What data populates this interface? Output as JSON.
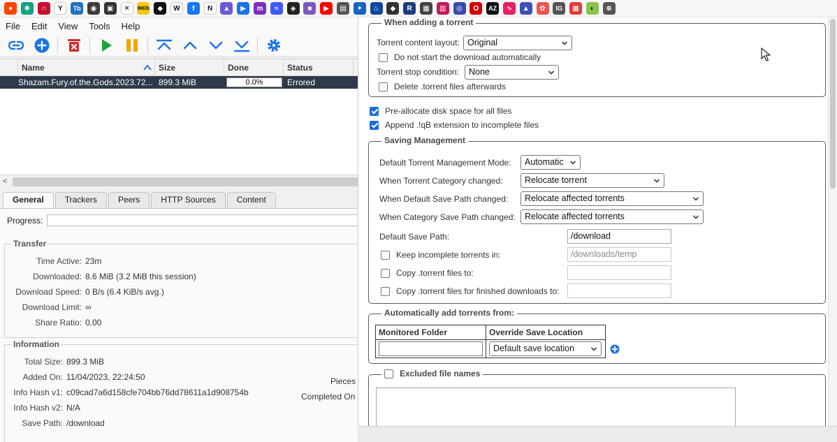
{
  "bookmarks": [
    {
      "icon": "reddit-icon",
      "color": "#ff4500",
      "glyph": "●"
    },
    {
      "icon": "chatgpt-icon",
      "color": "#10a37f",
      "glyph": "✺"
    },
    {
      "icon": "headphones-icon",
      "color": "#c8102e",
      "glyph": "∩"
    },
    {
      "icon": "yahoo-icon",
      "color": "#ffffff",
      "glyph": "Y"
    },
    {
      "icon": "tb-icon",
      "color": "#1e73be",
      "glyph": "Tb"
    },
    {
      "icon": "ring-icon",
      "color": "#3b3b3b",
      "glyph": "◉"
    },
    {
      "icon": "monitor-icon",
      "color": "#333333",
      "glyph": "▣"
    },
    {
      "icon": "x-icon",
      "color": "#ffffff",
      "glyph": "✕"
    },
    {
      "icon": "imdb-icon",
      "color": "#f5c518",
      "glyph": "IMDb"
    },
    {
      "icon": "badge-icon",
      "color": "#111111",
      "glyph": "◆"
    },
    {
      "icon": "wikipedia-icon",
      "color": "#ffffff",
      "glyph": "W"
    },
    {
      "icon": "facebook-icon",
      "color": "#1877f2",
      "glyph": "f"
    },
    {
      "icon": "netflix-icon",
      "color": "#ffffff",
      "glyph": "N"
    },
    {
      "icon": "triangle-icon",
      "color": "#6b5bd2",
      "glyph": "▲"
    },
    {
      "icon": "play-icon",
      "color": "#1a73e8",
      "glyph": "▶"
    },
    {
      "icon": "m-icon",
      "color": "#7b2fbf",
      "glyph": "m"
    },
    {
      "icon": "wifi-icon",
      "color": "#3d5afe",
      "glyph": "≈"
    },
    {
      "icon": "film-icon",
      "color": "#222222",
      "glyph": "◈"
    },
    {
      "icon": "camera-icon",
      "color": "#7e57c2",
      "glyph": "■"
    },
    {
      "icon": "youtube-icon",
      "color": "#ff0000",
      "glyph": "▶"
    },
    {
      "icon": "stack-icon",
      "color": "#555555",
      "glyph": "▤"
    },
    {
      "icon": "app-icon",
      "color": "#1565c0",
      "glyph": "✦"
    },
    {
      "icon": "droplet-icon",
      "color": "#0d47a1",
      "glyph": "♨"
    },
    {
      "icon": "eye-icon",
      "color": "#333333",
      "glyph": "◆"
    },
    {
      "icon": "r-icon",
      "color": "#1a3d7c",
      "glyph": "R"
    },
    {
      "icon": "window-icon",
      "color": "#444444",
      "glyph": "▦"
    },
    {
      "icon": "puzzle-icon",
      "color": "#c2185b",
      "glyph": "▥"
    },
    {
      "icon": "disk-icon",
      "color": "#3949ab",
      "glyph": "◎"
    },
    {
      "icon": "o-icon",
      "color": "#d50000",
      "glyph": "O"
    },
    {
      "icon": "az-icon",
      "color": "#111111",
      "glyph": "AZ"
    },
    {
      "icon": "wave-icon",
      "color": "#e91e63",
      "glyph": "∿"
    },
    {
      "icon": "photo-icon",
      "color": "#3f51b5",
      "glyph": "▲"
    },
    {
      "icon": "flower-icon",
      "color": "#ef5350",
      "glyph": "✿"
    },
    {
      "icon": "ig-icon",
      "color": "#555555",
      "glyph": "IG"
    },
    {
      "icon": "grid-icon",
      "color": "#e53935",
      "glyph": "▩"
    },
    {
      "icon": "melon-icon",
      "color": "#8bc34a",
      "glyph": "◐"
    },
    {
      "icon": "globe-icon",
      "color": "#555555",
      "glyph": "⊕"
    }
  ],
  "menu": [
    "File",
    "Edit",
    "View",
    "Tools",
    "Help"
  ],
  "torrent_table": {
    "columns": [
      "Name",
      "Size",
      "Done",
      "Status"
    ],
    "row": {
      "name": "Shazam.Fury.of.the.Gods.2023.72...",
      "size": "899.3 MiB",
      "done": "0.0%",
      "status": "Errored"
    }
  },
  "tabs": [
    "General",
    "Trackers",
    "Peers",
    "HTTP Sources",
    "Content"
  ],
  "general": {
    "progress_label": "Progress:",
    "transfer_title": "Transfer",
    "transfer": [
      {
        "k": "Time Active:",
        "v": "23m"
      },
      {
        "k": "Downloaded:",
        "v": "8.6 MiB (3.2 MiB this session)"
      },
      {
        "k": "Download Speed:",
        "v": "0 B/s (6.4 KiB/s avg.)"
      },
      {
        "k": "Download Limit:",
        "v": "∞"
      },
      {
        "k": "Share Ratio:",
        "v": "0.00"
      }
    ],
    "info_title": "Information",
    "info": [
      {
        "k": "Total Size:",
        "v": "899.3 MiB"
      },
      {
        "k": "Added On:",
        "v": "11/04/2023, 22:24:50"
      },
      {
        "k": "Info Hash v1:",
        "v": "c09cad7a6d158cfe704bb76dd78611a1d908754b"
      },
      {
        "k": "Info Hash v2:",
        "v": "N/A"
      },
      {
        "k": "Save Path:",
        "v": "/download"
      }
    ],
    "pieces_label": "Pieces",
    "completed_on_label": "Completed On"
  },
  "settings": {
    "adding_title": "When adding a torrent",
    "content_layout_label": "Torrent content layout:",
    "content_layout_value": "Original",
    "no_start_label": "Do not start the download automatically",
    "stop_condition_label": "Torrent stop condition:",
    "stop_condition_value": "None",
    "delete_torrent_label": "Delete .torrent files afterwards",
    "preallocate_label": "Pre-allocate disk space for all files",
    "append_ext_label": "Append .!qB extension to incomplete files",
    "saving_title": "Saving Management",
    "tmm_mode_label": "Default Torrent Management Mode:",
    "tmm_mode_value": "Automatic",
    "category_changed_label": "When Torrent Category changed:",
    "category_changed_value": "Relocate torrent",
    "default_path_changed_label": "When Default Save Path changed:",
    "default_path_changed_value": "Relocate affected torrents",
    "category_path_changed_label": "When Category Save Path changed:",
    "category_path_changed_value": "Relocate affected torrents",
    "default_save_path_label": "Default Save Path:",
    "default_save_path_value": "/download",
    "keep_incomplete_label": "Keep incomplete torrents in:",
    "keep_incomplete_value": "/downloads/temp",
    "copy_torrent_label": "Copy .torrent files to:",
    "copy_finished_label": "Copy .torrent files for finished downloads to:",
    "auto_add_title": "Automatically add torrents from:",
    "monitored_folder_header": "Monitored Folder",
    "override_location_header": "Override Save Location",
    "override_location_value": "Default save location",
    "excluded_title": "Excluded file names"
  }
}
